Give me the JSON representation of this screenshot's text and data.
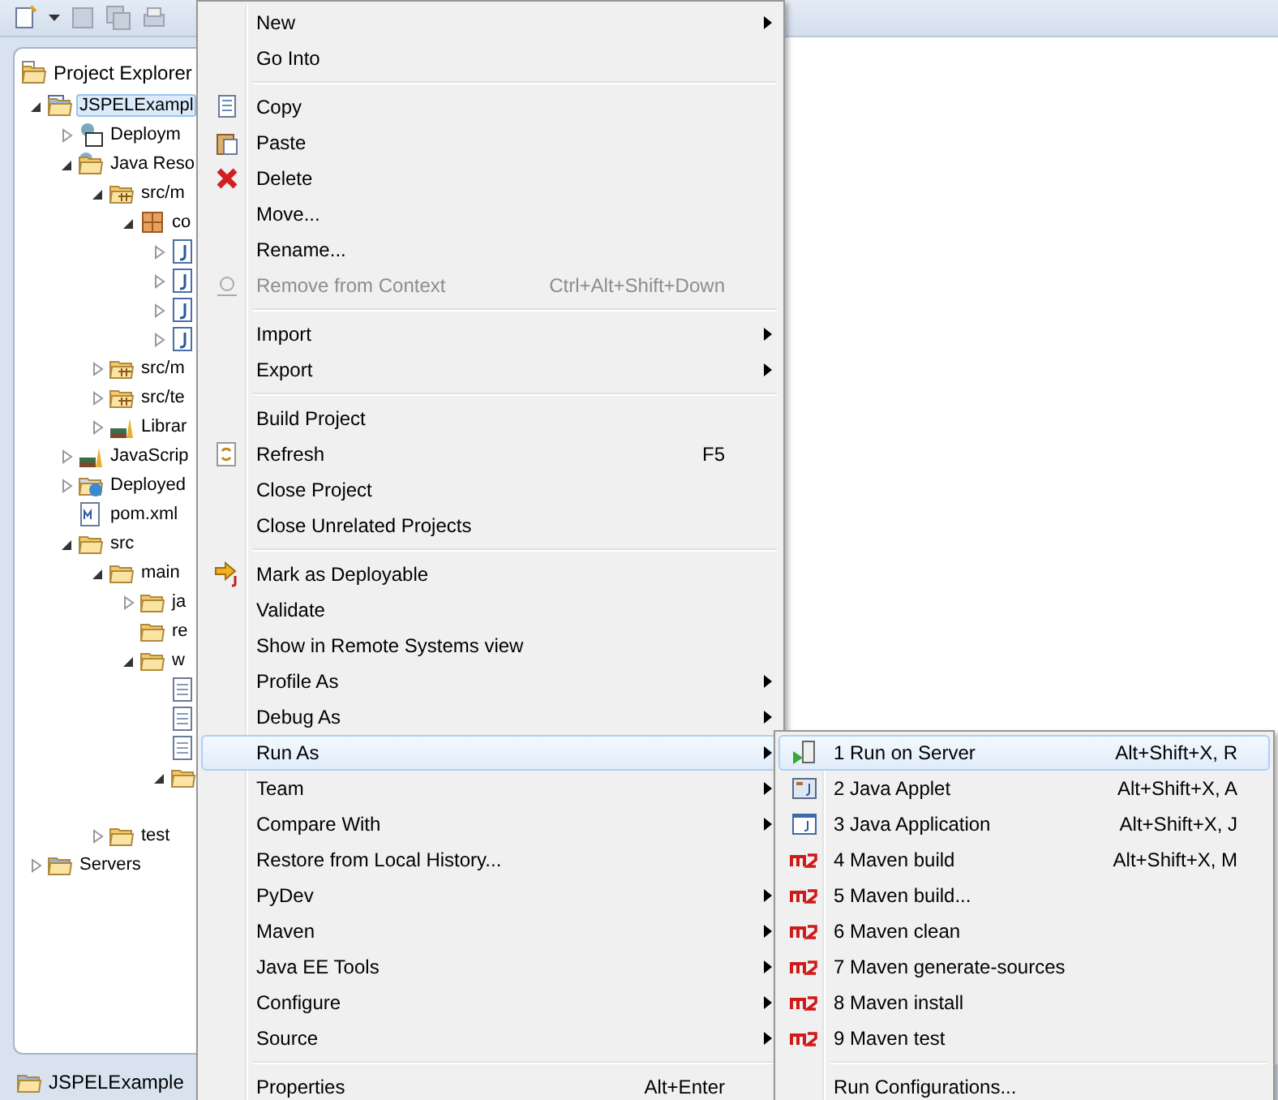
{
  "explorer": {
    "title": "Project Explorer",
    "tree": [
      {
        "kind": "project",
        "label": "JSPELExampl",
        "selected": true,
        "expanded": true,
        "children": [
          {
            "kind": "deployment",
            "label": "Deploym",
            "selected": false,
            "expanded": false
          },
          {
            "kind": "java-resources",
            "label": "Java Reso",
            "selected": false,
            "expanded": true,
            "children": [
              {
                "kind": "source-folder",
                "label": "src/m",
                "selected": false,
                "expanded": true,
                "children": [
                  {
                    "kind": "package",
                    "label": "co",
                    "selected": false,
                    "expanded": true,
                    "children": [
                      {
                        "kind": "java-file",
                        "selected": false,
                        "expanded": false
                      },
                      {
                        "kind": "java-file",
                        "selected": false,
                        "expanded": false
                      },
                      {
                        "kind": "java-file",
                        "selected": false,
                        "expanded": false
                      },
                      {
                        "kind": "java-file",
                        "selected": false,
                        "expanded": false
                      }
                    ]
                  }
                ]
              },
              {
                "kind": "source-folder",
                "label": "src/m",
                "selected": false,
                "expanded": false
              },
              {
                "kind": "source-folder",
                "label": "src/te",
                "selected": false,
                "expanded": false
              },
              {
                "kind": "library",
                "label": "Librar",
                "selected": false,
                "expanded": false
              }
            ]
          },
          {
            "kind": "library",
            "label": "JavaScrip",
            "selected": false,
            "expanded": false
          },
          {
            "kind": "deployed",
            "label": "Deployed",
            "selected": false,
            "expanded": false
          },
          {
            "kind": "xml-file",
            "label": "pom.xml",
            "selected": false
          },
          {
            "kind": "folder",
            "label": "src",
            "selected": false,
            "expanded": true,
            "children": [
              {
                "kind": "folder",
                "label": "main",
                "selected": false,
                "expanded": true,
                "children": [
                  {
                    "kind": "folder",
                    "label": "ja",
                    "selected": false,
                    "expanded": false
                  },
                  {
                    "kind": "folder",
                    "label": "re",
                    "selected": false
                  },
                  {
                    "kind": "folder",
                    "label": "w",
                    "selected": false,
                    "expanded": true,
                    "children": [
                      {
                        "kind": "web-file",
                        "selected": false
                      },
                      {
                        "kind": "web-file",
                        "selected": false
                      },
                      {
                        "kind": "web-file",
                        "selected": false
                      },
                      {
                        "kind": "folder",
                        "selected": false,
                        "expanded": true
                      }
                    ]
                  }
                ]
              },
              {
                "kind": "folder",
                "label": "test",
                "selected": false,
                "expanded": false
              }
            ]
          }
        ]
      },
      {
        "kind": "servers",
        "label": "Servers",
        "selected": false,
        "expanded": false
      }
    ]
  },
  "status_bar": {
    "label": "JSPELExample"
  },
  "context_menu": {
    "sections": [
      [
        {
          "kind": "plain",
          "label": "New",
          "submenu": true,
          "disabled": false,
          "selected": false
        },
        {
          "kind": "plain",
          "label": "Go Into",
          "submenu": false,
          "disabled": false,
          "selected": false
        }
      ],
      [
        {
          "kind": "copy",
          "label": "Copy",
          "submenu": false,
          "disabled": false,
          "selected": false
        },
        {
          "kind": "paste",
          "label": "Paste",
          "submenu": false,
          "disabled": false,
          "selected": false
        },
        {
          "kind": "delete",
          "label": "Delete",
          "submenu": false,
          "disabled": false,
          "selected": false
        },
        {
          "kind": "plain",
          "label": "Move...",
          "submenu": false,
          "disabled": false,
          "selected": false
        },
        {
          "kind": "plain",
          "label": "Rename...",
          "submenu": false,
          "disabled": false,
          "selected": false
        },
        {
          "kind": "context",
          "label": "Remove from Context",
          "shortcut": "Ctrl+Alt+Shift+Down",
          "submenu": false,
          "disabled": true,
          "selected": false
        }
      ],
      [
        {
          "kind": "plain",
          "label": "Import",
          "submenu": true,
          "disabled": false,
          "selected": false
        },
        {
          "kind": "plain",
          "label": "Export",
          "submenu": true,
          "disabled": false,
          "selected": false
        }
      ],
      [
        {
          "kind": "plain",
          "label": "Build Project",
          "submenu": false,
          "disabled": false,
          "selected": false
        },
        {
          "kind": "refresh",
          "label": "Refresh",
          "shortcut": "F5",
          "submenu": false,
          "disabled": false,
          "selected": false
        },
        {
          "kind": "plain",
          "label": "Close Project",
          "submenu": false,
          "disabled": false,
          "selected": false
        },
        {
          "kind": "plain",
          "label": "Close Unrelated Projects",
          "submenu": false,
          "disabled": false,
          "selected": false
        }
      ],
      [
        {
          "kind": "deploy",
          "label": "Mark as Deployable",
          "submenu": false,
          "disabled": false,
          "selected": false
        },
        {
          "kind": "plain",
          "label": "Validate",
          "submenu": false,
          "disabled": false,
          "selected": false
        },
        {
          "kind": "plain",
          "label": "Show in Remote Systems view",
          "submenu": false,
          "disabled": false,
          "selected": false
        },
        {
          "kind": "plain",
          "label": "Profile As",
          "submenu": true,
          "disabled": false,
          "selected": false
        },
        {
          "kind": "plain",
          "label": "Debug As",
          "submenu": true,
          "disabled": false,
          "selected": false
        },
        {
          "kind": "plain",
          "label": "Run As",
          "submenu": true,
          "disabled": false,
          "selected": true
        },
        {
          "kind": "plain",
          "label": "Team",
          "submenu": true,
          "disabled": false,
          "selected": false
        },
        {
          "kind": "plain",
          "label": "Compare With",
          "submenu": true,
          "disabled": false,
          "selected": false
        },
        {
          "kind": "plain",
          "label": "Restore from Local History...",
          "submenu": false,
          "disabled": false,
          "selected": false
        },
        {
          "kind": "plain",
          "label": "PyDev",
          "submenu": true,
          "disabled": false,
          "selected": false
        },
        {
          "kind": "plain",
          "label": "Maven",
          "submenu": true,
          "disabled": false,
          "selected": false
        },
        {
          "kind": "plain",
          "label": "Java EE Tools",
          "submenu": true,
          "disabled": false,
          "selected": false
        },
        {
          "kind": "plain",
          "label": "Configure",
          "submenu": true,
          "disabled": false,
          "selected": false
        },
        {
          "kind": "plain",
          "label": "Source",
          "submenu": true,
          "disabled": false,
          "selected": false
        }
      ],
      [
        {
          "kind": "plain",
          "label": "Properties",
          "shortcut": "Alt+Enter",
          "submenu": false,
          "disabled": false,
          "selected": false
        }
      ]
    ]
  },
  "run_as_menu": {
    "sections": [
      [
        {
          "kind": "server",
          "label": "1 Run on Server",
          "shortcut": "Alt+Shift+X, R",
          "selected": true
        },
        {
          "kind": "applet",
          "label": "2 Java Applet",
          "shortcut": "Alt+Shift+X, A",
          "selected": false
        },
        {
          "kind": "application",
          "label": "3 Java Application",
          "shortcut": "Alt+Shift+X, J",
          "selected": false
        },
        {
          "kind": "maven",
          "label": "4 Maven build",
          "shortcut": "Alt+Shift+X, M",
          "selected": false
        },
        {
          "kind": "maven",
          "label": "5 Maven build...",
          "selected": false
        },
        {
          "kind": "maven",
          "label": "6 Maven clean",
          "selected": false
        },
        {
          "kind": "maven",
          "label": "7 Maven generate-sources",
          "selected": false
        },
        {
          "kind": "maven",
          "label": "8 Maven install",
          "selected": false
        },
        {
          "kind": "maven",
          "label": "9 Maven test",
          "selected": false
        }
      ],
      [
        {
          "kind": "plain",
          "label": "Run Configurations...",
          "selected": false
        }
      ]
    ]
  }
}
